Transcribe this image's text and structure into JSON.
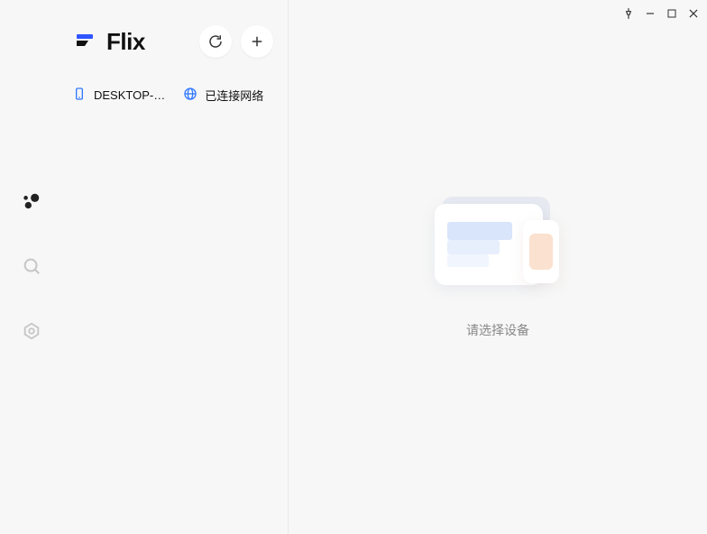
{
  "window": {
    "pin": "pin",
    "minimize": "minimize",
    "maximize": "maximize",
    "close": "close"
  },
  "brand": {
    "name": "Flix"
  },
  "panel": {
    "refresh": "refresh",
    "add": "add"
  },
  "status": {
    "device_label": "DESKTOP-…",
    "network_label": "已连接网络"
  },
  "rail": {
    "devices": "devices",
    "search": "search",
    "settings": "settings"
  },
  "main": {
    "empty_message": "请选择设备"
  }
}
